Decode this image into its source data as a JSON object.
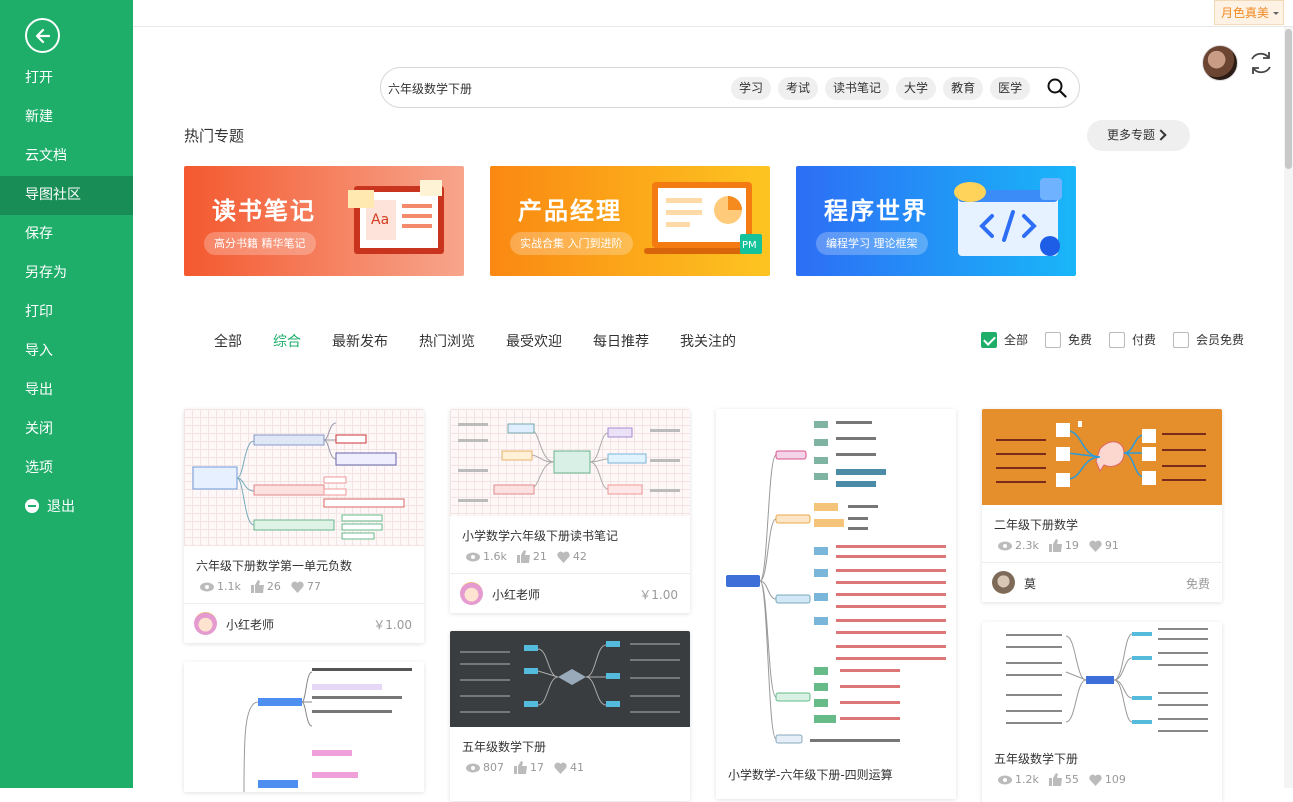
{
  "sidebar": {
    "back_icon": "arrow-left-circle-icon",
    "items": [
      {
        "label": "打开"
      },
      {
        "label": "新建"
      },
      {
        "label": "云文档"
      },
      {
        "label": "导图社区"
      },
      {
        "label": "保存"
      },
      {
        "label": "另存为"
      },
      {
        "label": "打印"
      },
      {
        "label": "导入"
      },
      {
        "label": "导出"
      },
      {
        "label": "关闭"
      },
      {
        "label": "选项"
      },
      {
        "label": "退出"
      }
    ],
    "active_index": 3,
    "background": "#1fae6a"
  },
  "topbar": {
    "theme_label": "月色真美"
  },
  "search": {
    "value": "六年级数学下册",
    "tags": [
      "学习",
      "考试",
      "读书笔记",
      "大学",
      "教育",
      "医学"
    ]
  },
  "hot": {
    "title": "热门专题",
    "more_label": "更多专题",
    "banners": [
      {
        "title": "读书笔记",
        "subtitle": "高分书籍 精华笔记"
      },
      {
        "title": "产品经理",
        "subtitle": "实战合集 入门到进阶"
      },
      {
        "title": "程序世界",
        "subtitle": "编程学习 理论框架"
      }
    ]
  },
  "filters": {
    "tabs": [
      "全部",
      "综合",
      "最新发布",
      "热门浏览",
      "最受欢迎",
      "每日推荐",
      "我关注的"
    ],
    "active_tab": "综合",
    "checks": [
      {
        "label": "全部",
        "checked": true
      },
      {
        "label": "免费",
        "checked": false
      },
      {
        "label": "付费",
        "checked": false
      },
      {
        "label": "会员免费",
        "checked": false
      }
    ]
  },
  "cards": [
    {
      "title": "六年级下册数学第一单元负数",
      "views": "1.1k",
      "likes": "26",
      "favs": "77",
      "author": "小红老师",
      "price": "￥1.00"
    },
    {
      "title": "小学数学六年级下册读书笔记",
      "views": "1.6k",
      "likes": "21",
      "favs": "42",
      "author": "小红老师",
      "price": "￥1.00"
    },
    {
      "title": "五年级数学下册",
      "views": "807",
      "likes": "17",
      "favs": "41"
    },
    {
      "title": "小学数学-六年级下册-四则运算"
    },
    {
      "title": "二年级下册数学",
      "views": "2.3k",
      "likes": "19",
      "favs": "91",
      "author": "莫",
      "price": "免费"
    },
    {
      "title": "五年级数学下册",
      "views": "1.2k",
      "likes": "55",
      "favs": "109"
    }
  ],
  "colors": {
    "accent": "#1fae6a",
    "theme": "#f08a24"
  }
}
